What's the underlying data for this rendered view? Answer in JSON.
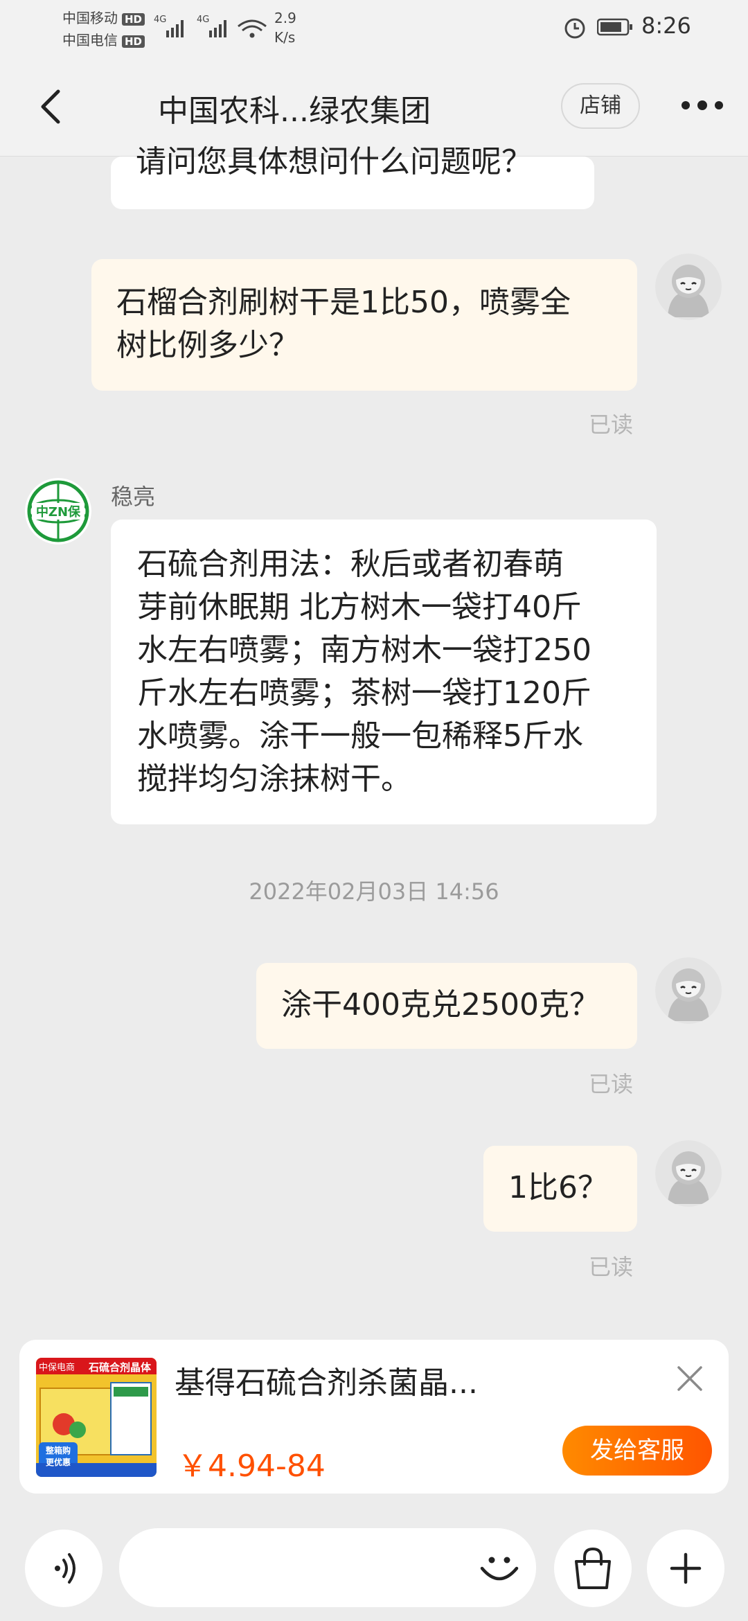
{
  "status_bar": {
    "carrier1": "中国移动",
    "carrier2": "中国电信",
    "hd_badge": "HD",
    "net1": "4G",
    "net2": "4G",
    "speed_value": "2.9",
    "speed_unit": "K/s",
    "time": "8:26"
  },
  "header": {
    "title": "中国农科...绿农集团",
    "shop_button": "店铺"
  },
  "messages": {
    "m0_text": "请问您具体想问什么问题呢？",
    "m1_line1": "石榴合剂刷树干是1比50，喷雾全",
    "m1_line2": "树比例多少？",
    "read_label": "已读",
    "sender_name": "稳亮",
    "m2_lines": [
      "石硫合剂用法：秋后或者初春萌",
      "芽前休眠期 北方树木一袋打40斤",
      "水左右喷雾；南方树木一袋打250",
      "斤水左右喷雾；茶树一袋打120斤",
      "水喷雾。涂干一般一包稀释5斤水",
      "搅拌均匀涂抹树干。"
    ],
    "timestamp": "2022年02月03日 14:56",
    "m3_text": "涂干400克兑2500克？",
    "m4_text": "1比6？"
  },
  "product_card": {
    "name": "基得石硫合剂杀菌晶...",
    "price": "￥4.94-84",
    "send_button": "发给客服",
    "thumb_banner": "石硫合剂晶体",
    "thumb_badge_line1": "整箱购",
    "thumb_badge_line2": "更优惠",
    "thumb_store_label": "中保电商"
  },
  "colors": {
    "accent_orange": "#ff5000",
    "bubble_self": "#fff8ec",
    "bubble_other": "#ffffff",
    "background": "#ececec"
  },
  "icons": {
    "back": "chevron-left-icon",
    "more": "more-dots-icon",
    "close": "close-icon",
    "voice": "voice-icon",
    "emoji": "emoji-icon",
    "bag": "shopping-bag-icon",
    "plus": "plus-icon"
  }
}
